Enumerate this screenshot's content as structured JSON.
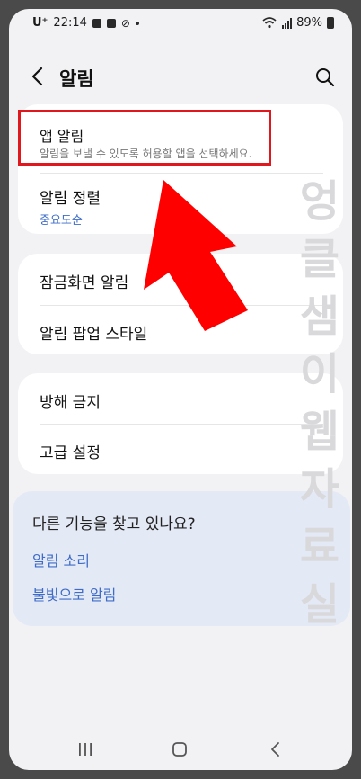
{
  "status_bar": {
    "carrier": "U⁺",
    "time": "22:14",
    "battery": "89%"
  },
  "header": {
    "title": "알림"
  },
  "group1": {
    "app_notifications": {
      "label": "앱 알림",
      "description": "알림을 보낼 수 있도록 허용할 앱을 선택하세요."
    },
    "sort": {
      "label": "알림 정렬",
      "value": "중요도순"
    }
  },
  "group2": {
    "lockscreen": "잠금화면 알림",
    "popup_style": "알림 팝업 스타일"
  },
  "group3": {
    "dnd": "방해 금지",
    "advanced": "고급 설정"
  },
  "suggest": {
    "question": "다른 기능을 찾고 있나요?",
    "links": [
      "알림 소리",
      "불빛으로 알림"
    ]
  },
  "watermark": [
    "엉",
    "클",
    "샘",
    "이",
    "웹",
    "자",
    "료",
    "실"
  ],
  "colors": {
    "accent_link": "#3e6cc8",
    "highlight": "#e0181e",
    "arrow": "#ff0000"
  }
}
